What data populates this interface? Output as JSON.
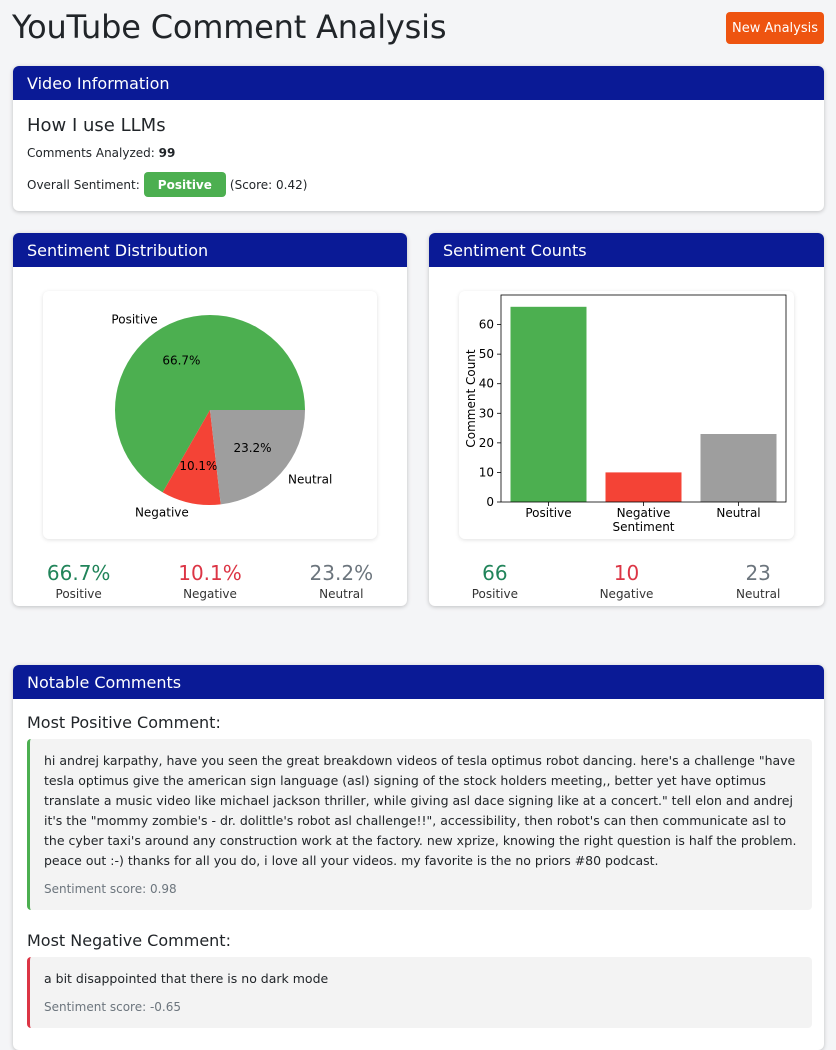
{
  "header": {
    "title": "YouTube Comment Analysis",
    "new_button": "New Analysis"
  },
  "video_info": {
    "heading": "Video Information",
    "title": "How I use LLMs",
    "comments_label": "Comments Analyzed:",
    "comments_count": "99",
    "sentiment_label": "Overall Sentiment:",
    "sentiment_badge": "Positive",
    "score_text": "(Score: 0.42)"
  },
  "distribution": {
    "heading": "Sentiment Distribution",
    "stats": [
      {
        "value": "66.7%",
        "label": "Positive"
      },
      {
        "value": "10.1%",
        "label": "Negative"
      },
      {
        "value": "23.2%",
        "label": "Neutral"
      }
    ]
  },
  "counts": {
    "heading": "Sentiment Counts",
    "stats": [
      {
        "value": "66",
        "label": "Positive"
      },
      {
        "value": "10",
        "label": "Negative"
      },
      {
        "value": "23",
        "label": "Neutral"
      }
    ]
  },
  "chart_data": [
    {
      "type": "pie",
      "labels": [
        "Positive",
        "Negative",
        "Neutral"
      ],
      "values": [
        66.7,
        10.1,
        23.2
      ],
      "value_labels": [
        "66.7%",
        "10.1%",
        "23.2%"
      ],
      "colors": [
        "#4caf50",
        "#f44336",
        "#9e9e9e"
      ]
    },
    {
      "type": "bar",
      "categories": [
        "Positive",
        "Negative",
        "Neutral"
      ],
      "values": [
        66,
        10,
        23
      ],
      "colors": [
        "#4caf50",
        "#f44336",
        "#9e9e9e"
      ],
      "xlabel": "Sentiment",
      "ylabel": "Comment Count",
      "ylim": [
        0,
        70
      ],
      "yticks": [
        0,
        10,
        20,
        30,
        40,
        50,
        60
      ]
    }
  ],
  "notable": {
    "heading": "Notable Comments",
    "positive_title": "Most Positive Comment:",
    "positive_text": "hi andrej karpathy, have you seen the great breakdown videos of tesla optimus robot dancing. here's a challenge \"have tesla optimus give the american sign language (asl) signing of the stock holders meeting,, better yet have optimus translate a music video like michael jackson thriller, while giving asl dace signing like at a concert.\" tell elon and andrej it's the \"mommy zombie's - dr. dolittle's robot asl challenge!!\", accessibility, then robot's can then communicate asl to the cyber taxi's around any construction work at the factory. new xprize, knowing the right question is half the problem. peace out :-) thanks for all you do, i love all your videos. my favorite is the no priors #80 podcast.",
    "positive_score": "Sentiment score: 0.98",
    "negative_title": "Most Negative Comment:",
    "negative_text": "a bit disappointed that there is no dark mode",
    "negative_score": "Sentiment score: -0.65"
  }
}
